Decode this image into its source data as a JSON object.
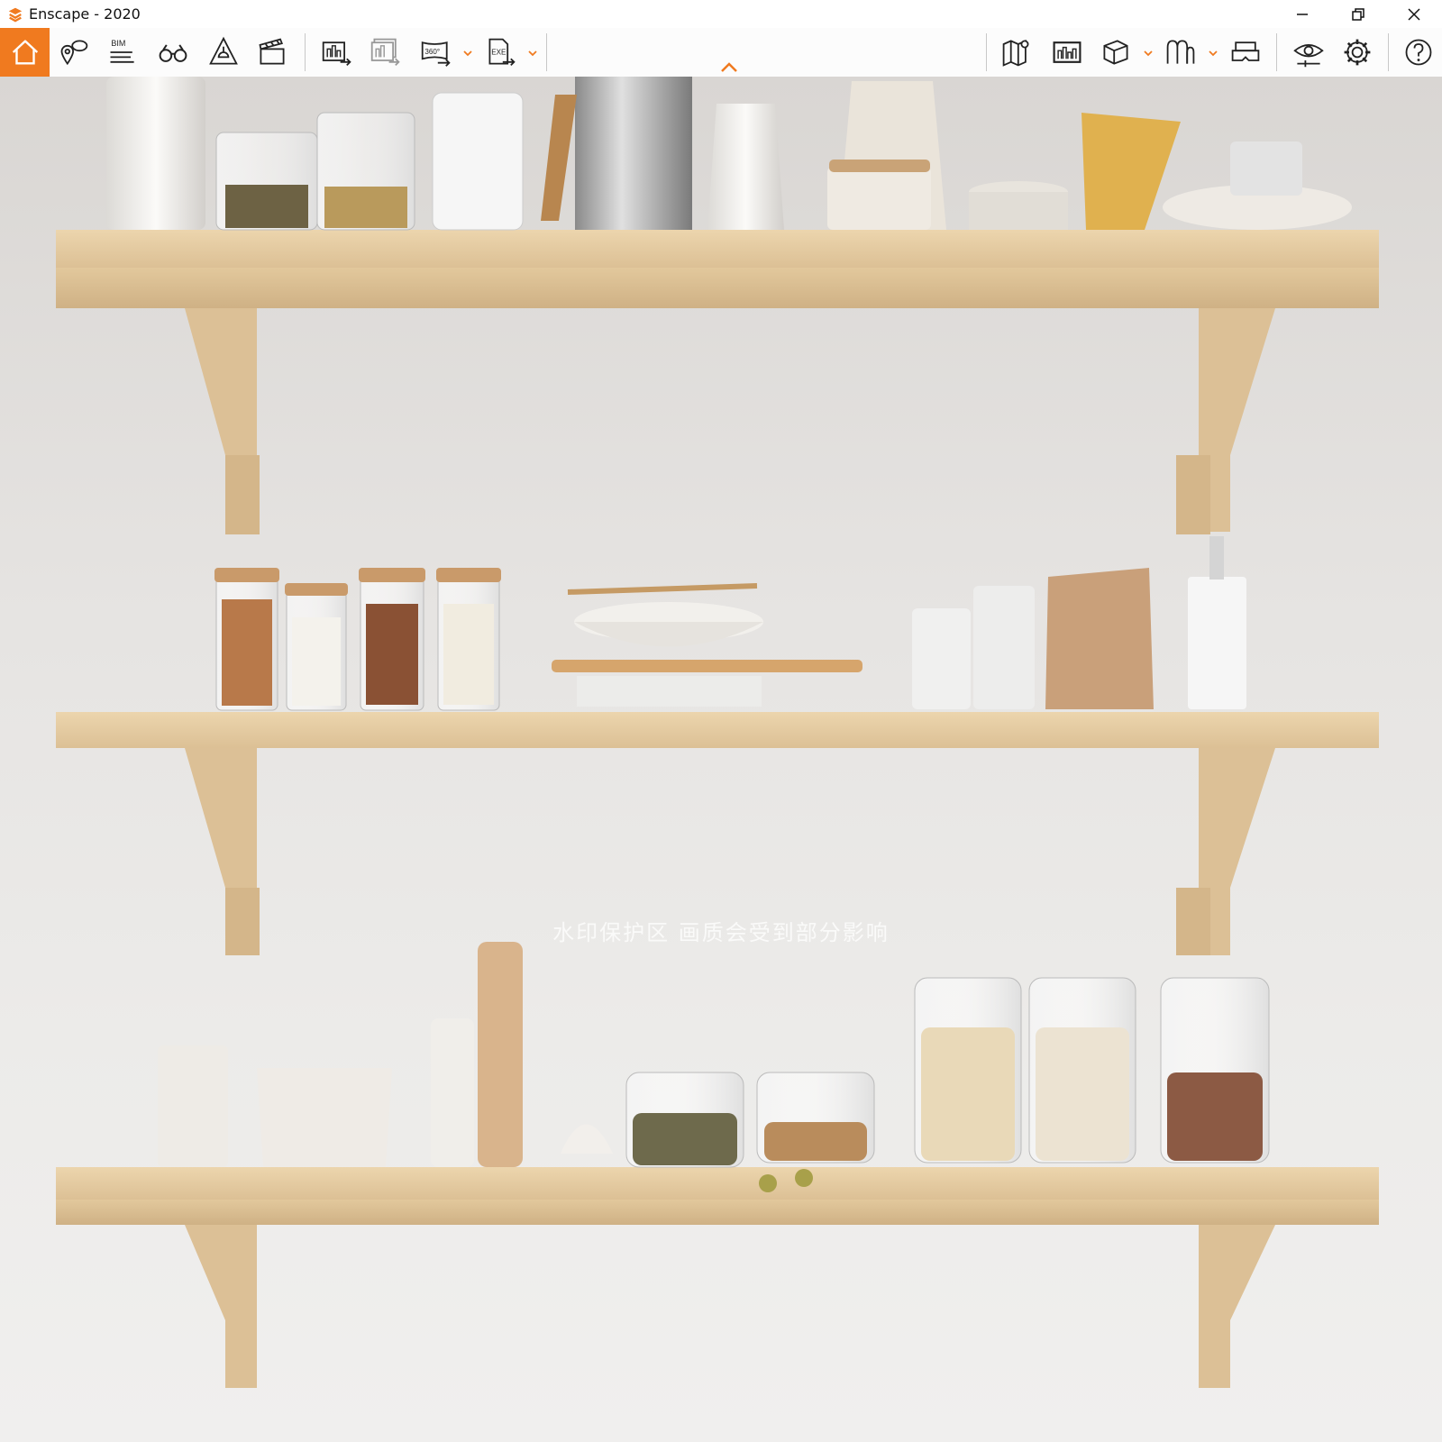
{
  "window": {
    "title": "Enscape - 2020",
    "accent_color": "#f07a1f",
    "controls": [
      "minimize-icon",
      "restore-icon",
      "close-icon"
    ]
  },
  "toolbar": {
    "left_group": [
      "home-icon",
      "map-pin-view-icon",
      "bim-icon",
      "binoculars-icon",
      "light-view-icon",
      "clapperboard-icon"
    ],
    "bim_label": "BIM",
    "export_group": [
      "render-screenshot-icon",
      "batch-render-icon",
      "panorama-360-icon",
      "exe-export-icon"
    ],
    "panorama_label": "360°",
    "exe_label": "EXE",
    "right_group": [
      "minimap-icon",
      "asset-library-icon",
      "material-cube-icon",
      "visual-settings-icon",
      "vr-headset-icon",
      "eye-icon",
      "gear-icon",
      "help-icon"
    ],
    "active_item": "home"
  },
  "viewport": {
    "watermark_text": "水印保护区  画质会受到部分影响",
    "background_color": "#e6e4e2",
    "wood_color": "#e7cfa6"
  }
}
